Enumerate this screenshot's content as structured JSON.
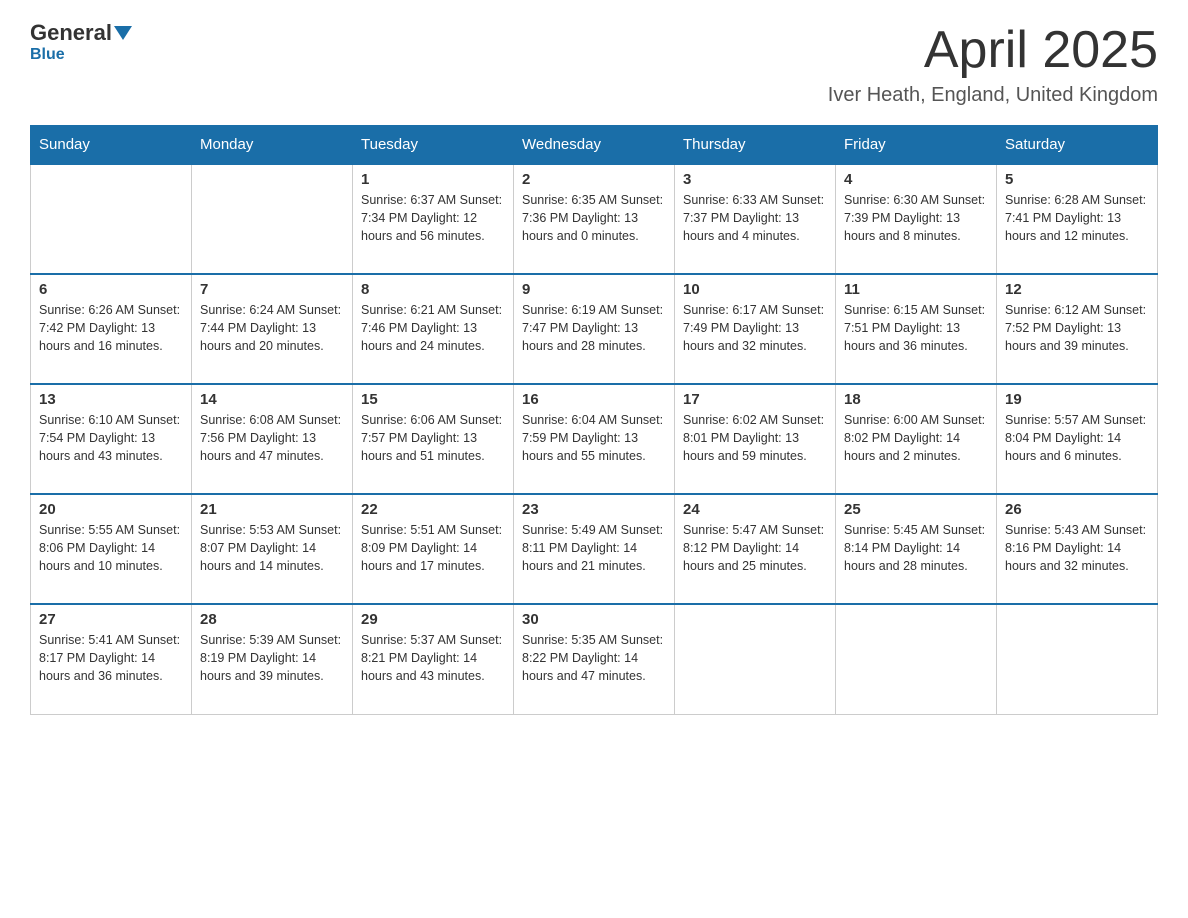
{
  "logo": {
    "general": "General",
    "blue": "Blue"
  },
  "header": {
    "title": "April 2025",
    "location": "Iver Heath, England, United Kingdom"
  },
  "weekdays": [
    "Sunday",
    "Monday",
    "Tuesday",
    "Wednesday",
    "Thursday",
    "Friday",
    "Saturday"
  ],
  "weeks": [
    [
      {
        "day": "",
        "info": ""
      },
      {
        "day": "",
        "info": ""
      },
      {
        "day": "1",
        "info": "Sunrise: 6:37 AM\nSunset: 7:34 PM\nDaylight: 12 hours\nand 56 minutes."
      },
      {
        "day": "2",
        "info": "Sunrise: 6:35 AM\nSunset: 7:36 PM\nDaylight: 13 hours\nand 0 minutes."
      },
      {
        "day": "3",
        "info": "Sunrise: 6:33 AM\nSunset: 7:37 PM\nDaylight: 13 hours\nand 4 minutes."
      },
      {
        "day": "4",
        "info": "Sunrise: 6:30 AM\nSunset: 7:39 PM\nDaylight: 13 hours\nand 8 minutes."
      },
      {
        "day": "5",
        "info": "Sunrise: 6:28 AM\nSunset: 7:41 PM\nDaylight: 13 hours\nand 12 minutes."
      }
    ],
    [
      {
        "day": "6",
        "info": "Sunrise: 6:26 AM\nSunset: 7:42 PM\nDaylight: 13 hours\nand 16 minutes."
      },
      {
        "day": "7",
        "info": "Sunrise: 6:24 AM\nSunset: 7:44 PM\nDaylight: 13 hours\nand 20 minutes."
      },
      {
        "day": "8",
        "info": "Sunrise: 6:21 AM\nSunset: 7:46 PM\nDaylight: 13 hours\nand 24 minutes."
      },
      {
        "day": "9",
        "info": "Sunrise: 6:19 AM\nSunset: 7:47 PM\nDaylight: 13 hours\nand 28 minutes."
      },
      {
        "day": "10",
        "info": "Sunrise: 6:17 AM\nSunset: 7:49 PM\nDaylight: 13 hours\nand 32 minutes."
      },
      {
        "day": "11",
        "info": "Sunrise: 6:15 AM\nSunset: 7:51 PM\nDaylight: 13 hours\nand 36 minutes."
      },
      {
        "day": "12",
        "info": "Sunrise: 6:12 AM\nSunset: 7:52 PM\nDaylight: 13 hours\nand 39 minutes."
      }
    ],
    [
      {
        "day": "13",
        "info": "Sunrise: 6:10 AM\nSunset: 7:54 PM\nDaylight: 13 hours\nand 43 minutes."
      },
      {
        "day": "14",
        "info": "Sunrise: 6:08 AM\nSunset: 7:56 PM\nDaylight: 13 hours\nand 47 minutes."
      },
      {
        "day": "15",
        "info": "Sunrise: 6:06 AM\nSunset: 7:57 PM\nDaylight: 13 hours\nand 51 minutes."
      },
      {
        "day": "16",
        "info": "Sunrise: 6:04 AM\nSunset: 7:59 PM\nDaylight: 13 hours\nand 55 minutes."
      },
      {
        "day": "17",
        "info": "Sunrise: 6:02 AM\nSunset: 8:01 PM\nDaylight: 13 hours\nand 59 minutes."
      },
      {
        "day": "18",
        "info": "Sunrise: 6:00 AM\nSunset: 8:02 PM\nDaylight: 14 hours\nand 2 minutes."
      },
      {
        "day": "19",
        "info": "Sunrise: 5:57 AM\nSunset: 8:04 PM\nDaylight: 14 hours\nand 6 minutes."
      }
    ],
    [
      {
        "day": "20",
        "info": "Sunrise: 5:55 AM\nSunset: 8:06 PM\nDaylight: 14 hours\nand 10 minutes."
      },
      {
        "day": "21",
        "info": "Sunrise: 5:53 AM\nSunset: 8:07 PM\nDaylight: 14 hours\nand 14 minutes."
      },
      {
        "day": "22",
        "info": "Sunrise: 5:51 AM\nSunset: 8:09 PM\nDaylight: 14 hours\nand 17 minutes."
      },
      {
        "day": "23",
        "info": "Sunrise: 5:49 AM\nSunset: 8:11 PM\nDaylight: 14 hours\nand 21 minutes."
      },
      {
        "day": "24",
        "info": "Sunrise: 5:47 AM\nSunset: 8:12 PM\nDaylight: 14 hours\nand 25 minutes."
      },
      {
        "day": "25",
        "info": "Sunrise: 5:45 AM\nSunset: 8:14 PM\nDaylight: 14 hours\nand 28 minutes."
      },
      {
        "day": "26",
        "info": "Sunrise: 5:43 AM\nSunset: 8:16 PM\nDaylight: 14 hours\nand 32 minutes."
      }
    ],
    [
      {
        "day": "27",
        "info": "Sunrise: 5:41 AM\nSunset: 8:17 PM\nDaylight: 14 hours\nand 36 minutes."
      },
      {
        "day": "28",
        "info": "Sunrise: 5:39 AM\nSunset: 8:19 PM\nDaylight: 14 hours\nand 39 minutes."
      },
      {
        "day": "29",
        "info": "Sunrise: 5:37 AM\nSunset: 8:21 PM\nDaylight: 14 hours\nand 43 minutes."
      },
      {
        "day": "30",
        "info": "Sunrise: 5:35 AM\nSunset: 8:22 PM\nDaylight: 14 hours\nand 47 minutes."
      },
      {
        "day": "",
        "info": ""
      },
      {
        "day": "",
        "info": ""
      },
      {
        "day": "",
        "info": ""
      }
    ]
  ]
}
